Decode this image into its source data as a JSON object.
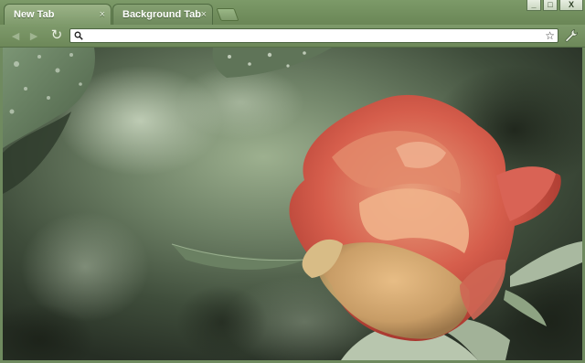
{
  "tabs": [
    {
      "label": "New Tab",
      "close": "×",
      "active": true
    },
    {
      "label": "Background Tab",
      "close": "×",
      "active": false
    }
  ],
  "window_controls": {
    "minimize": "_",
    "maximize": "□",
    "close": "X"
  },
  "toolbar": {
    "back_icon": "◄",
    "forward_icon": "►",
    "reload_icon": "↻",
    "omnibox": {
      "value": "",
      "placeholder": ""
    },
    "star_icon": "☆"
  },
  "theme": {
    "frame": "#6f8a5f",
    "tab_active": "#9bb387",
    "tab_inactive": "#84a071",
    "rose": "#d7574a",
    "leaf": "#5a6f55"
  }
}
